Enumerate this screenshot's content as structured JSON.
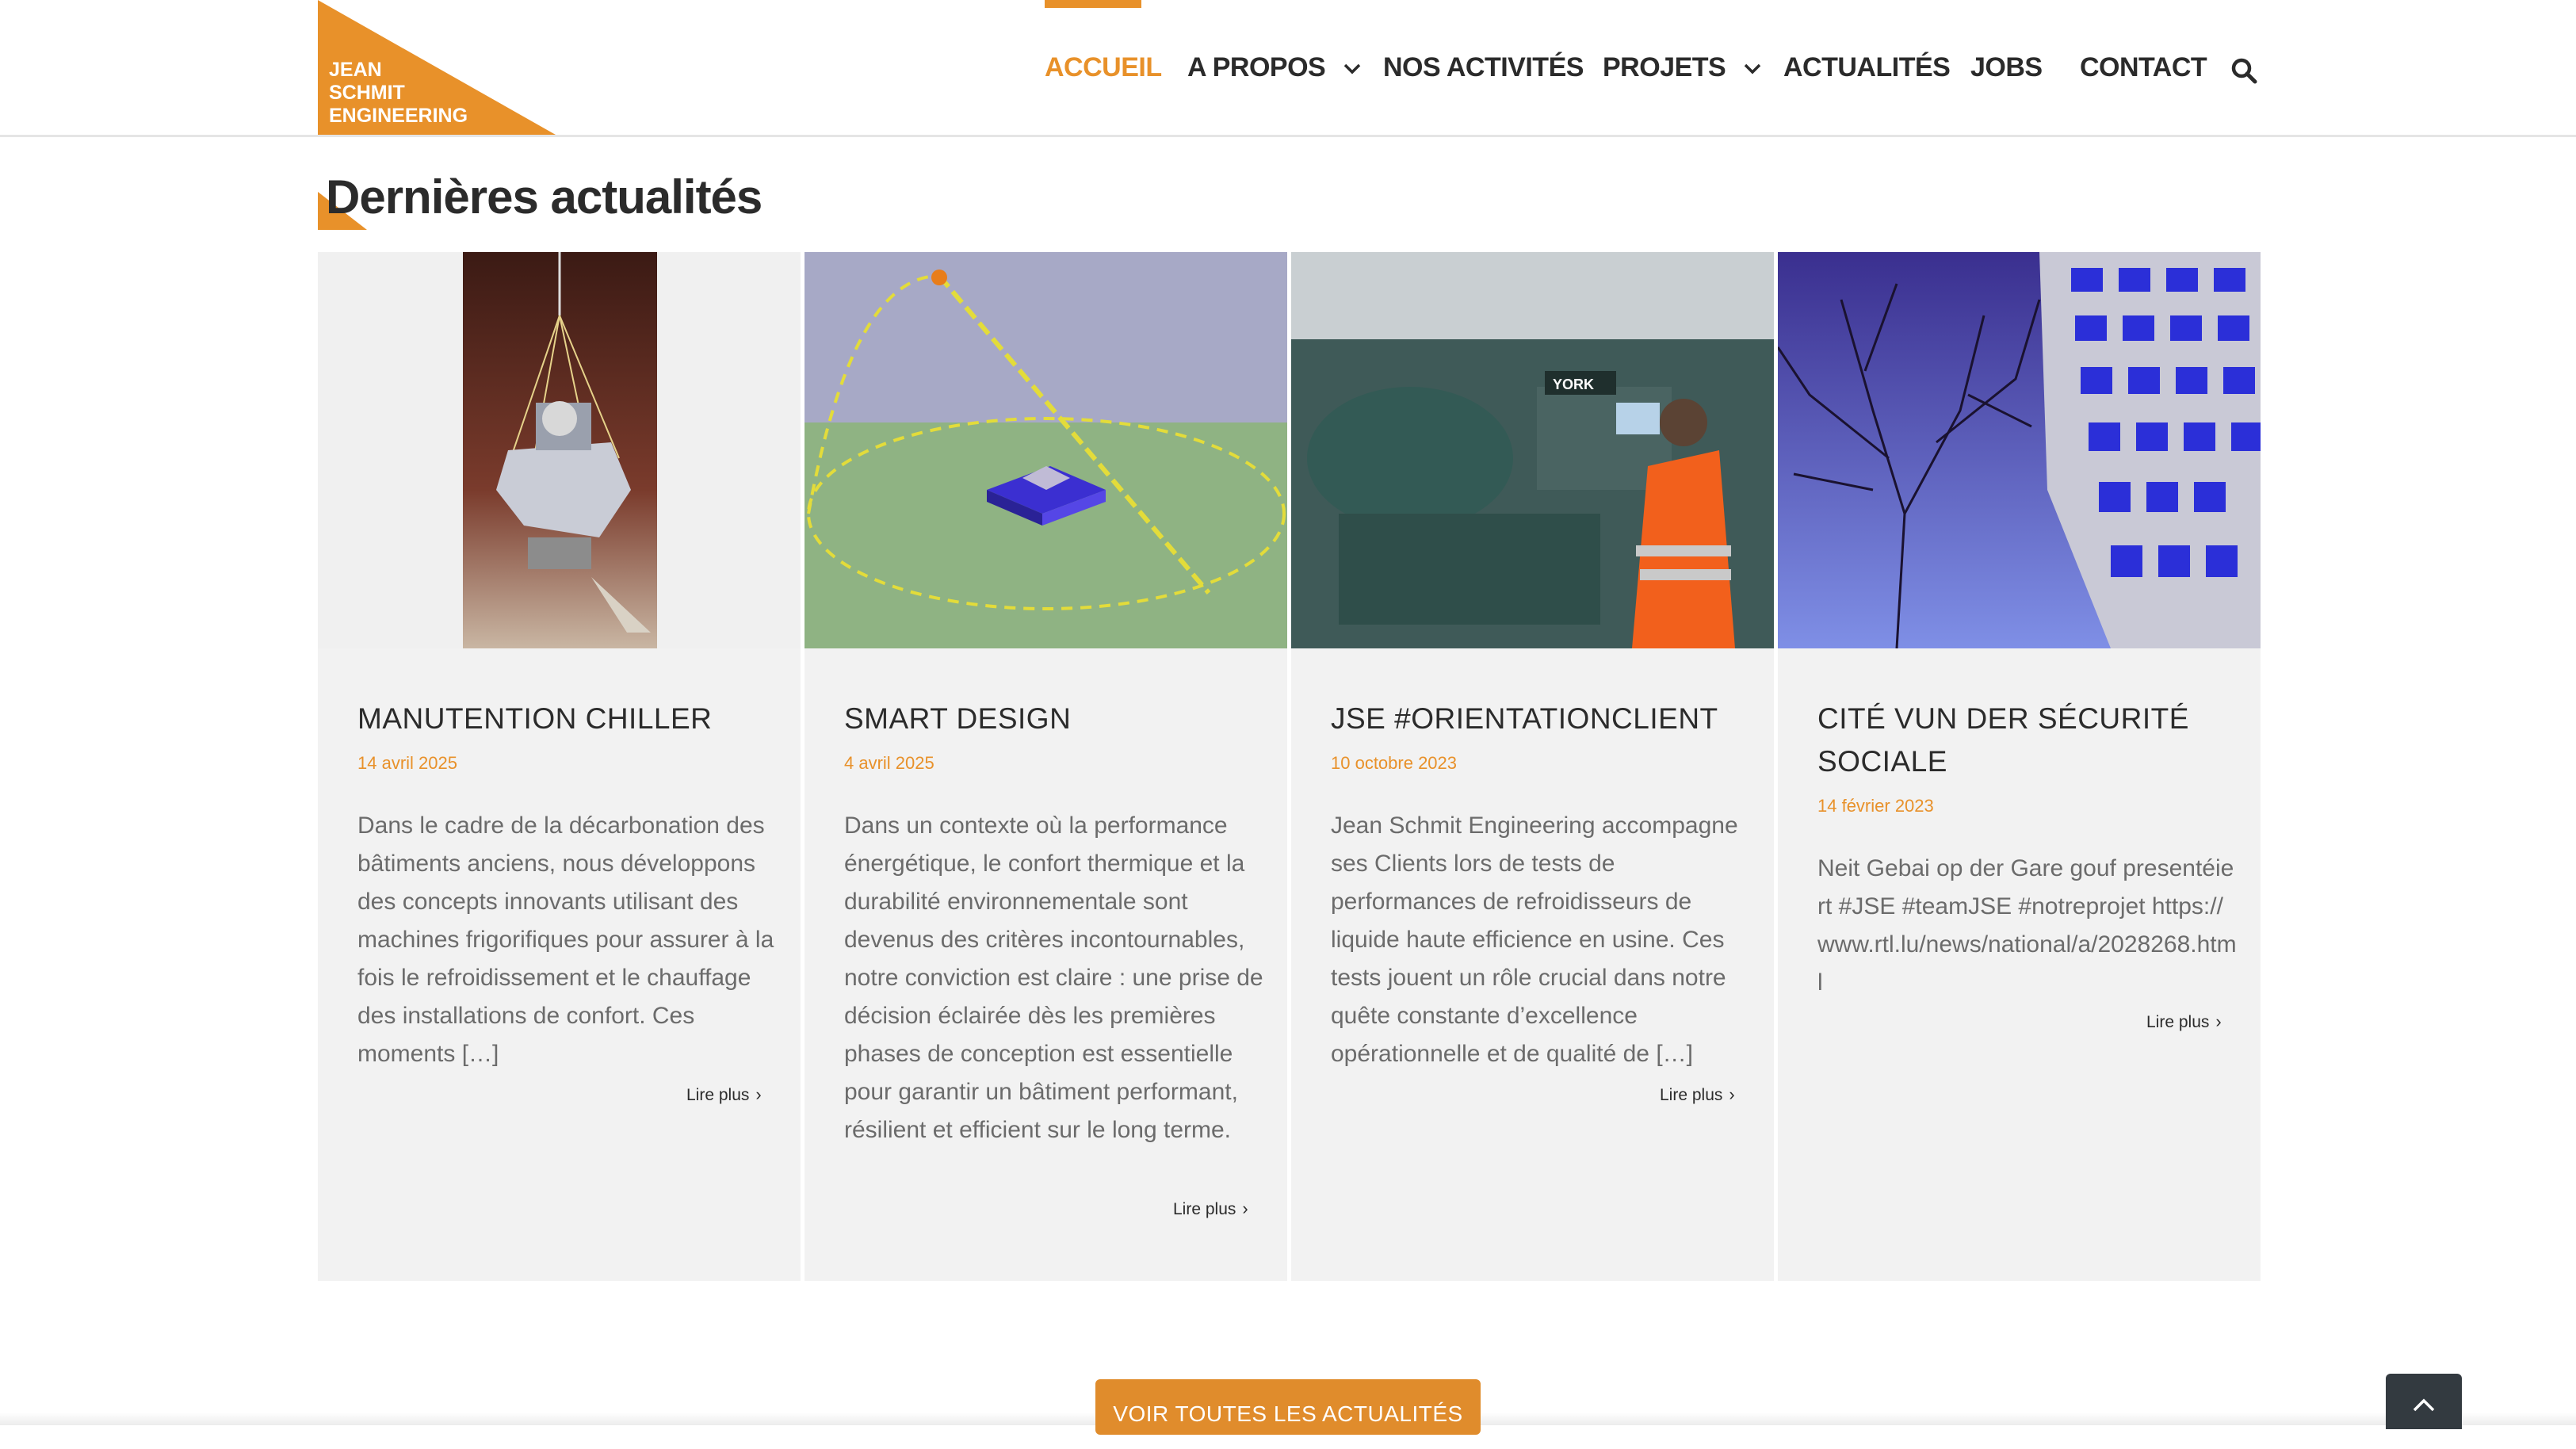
{
  "logo": {
    "lines": [
      "JEAN",
      "SCHMIT",
      "ENGINEERING"
    ]
  },
  "nav": {
    "items": [
      {
        "label": "ACCUEIL",
        "active": true
      },
      {
        "label": "A PROPOS",
        "dropdown": true
      },
      {
        "label": "NOS ACTIVITÉS"
      },
      {
        "label": "PROJETS",
        "dropdown": true
      },
      {
        "label": "ACTUALITÉS"
      },
      {
        "label": "JOBS"
      },
      {
        "label": "CONTACT"
      }
    ],
    "search_icon": "search-icon"
  },
  "section": {
    "title": "Dernières actualités"
  },
  "cards": [
    {
      "title": "MANUTENTION CHILLER",
      "date": "14 avril 2025",
      "excerpt": "Dans le cadre de la décarbonation des bâtiments anciens, nous développons des concepts innovants utilisant des machines frigorifiques pour assurer à la fois le refroidissement et le chauffage des installations de confort. Ces moments […]",
      "read_more": "Lire plus"
    },
    {
      "title": "SMART DESIGN",
      "date": "4 avril 2025",
      "excerpt": "Dans un contexte où la performance énergétique, le confort thermique et la durabilité environnementale sont devenus des critères incontournables, notre conviction est claire : une prise de décision éclairée dès les premières phases de conception est essentielle pour garantir un bâtiment performant, résilient et efficient sur le long terme.",
      "read_more": "Lire plus"
    },
    {
      "title": "JSE #ORIENTATIONCLIENT",
      "date": "10 octobre 2023",
      "excerpt": "Jean Schmit Engineering accompagne ses Clients lors de tests de performances de refroidisseurs de liquide haute efficience en usine. Ces tests jouent un rôle crucial dans notre quête constante d’excellence opérationnelle et de qualité de […]",
      "read_more": "Lire plus",
      "image_label": "YORK"
    },
    {
      "title": "CITÉ VUN DER SÉCURITÉ SOCIALE",
      "date": "14 février 2023",
      "excerpt": "Neit Gebai op der Gare gouf presentéiert #JSE #teamJSE #notreprojet https://www.rtl.lu/news/national/a/2028268.html",
      "read_more": "Lire plus"
    }
  ],
  "cta": {
    "label": "VOIR TOUTES LES ACTUALITÉS"
  },
  "colors": {
    "accent": "#e8912a",
    "card_bg": "#f2f2f2",
    "text": "#2b2b2b",
    "body": "#6b6b6b"
  }
}
